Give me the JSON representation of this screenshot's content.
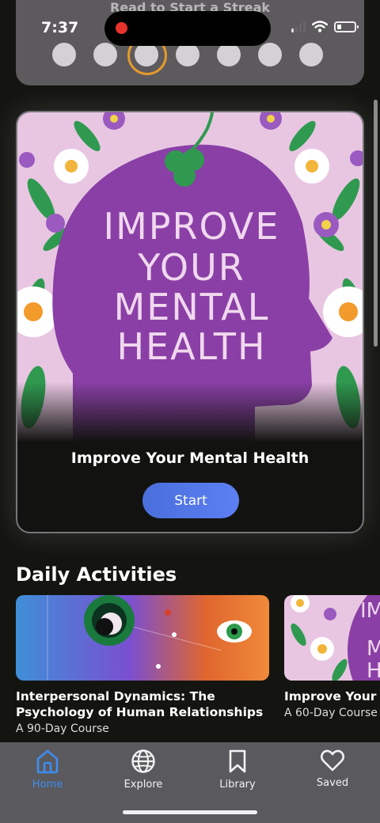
{
  "status_bar": {
    "time": "7:37"
  },
  "streak": {
    "title": "Read to Start a Streak",
    "days": 7,
    "current_day_index": 2
  },
  "featured": {
    "art_text": [
      "IMPROVE",
      "YOUR",
      "MENTAL",
      "HEALTH"
    ],
    "title": "Improve Your Mental Health",
    "start_label": "Start"
  },
  "daily": {
    "section_title": "Daily Activities",
    "items": [
      {
        "title": "Interpersonal Dynamics: The Psychology of Human Relationships",
        "subtitle": "A 90-Day Course"
      },
      {
        "title": "Improve Your Mental Health",
        "subtitle": "A 60-Day Course"
      }
    ]
  },
  "tabs": [
    {
      "label": "Home",
      "icon": "home-icon",
      "active": true
    },
    {
      "label": "Explore",
      "icon": "globe-icon",
      "active": false
    },
    {
      "label": "Library",
      "icon": "bookmark-icon",
      "active": false
    },
    {
      "label": "Saved",
      "icon": "heart-icon",
      "active": false
    }
  ],
  "colors": {
    "accent": "#3f8cf0",
    "start_button": "#5479e8",
    "streak_highlight": "#e49a2c",
    "art_purple": "#8a3fa6",
    "art_background": "#e8c6e2"
  }
}
